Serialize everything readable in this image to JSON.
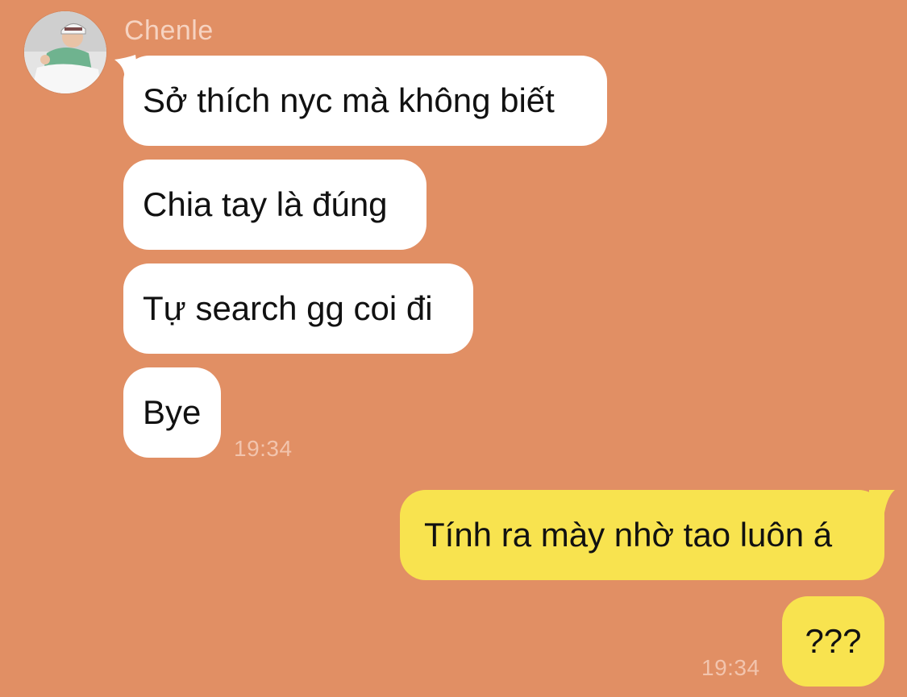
{
  "chat": {
    "contact_name": "Chenle",
    "colors": {
      "background": "#e18f64",
      "incoming_bubble": "#ffffff",
      "outgoing_bubble": "#f8e34f",
      "timestamp": "#f2c4ad"
    },
    "incoming": [
      {
        "text": "Sở thích nyc mà không biết"
      },
      {
        "text": "Chia tay là đúng"
      },
      {
        "text": "Tự search gg coi đi"
      },
      {
        "text": "Bye"
      }
    ],
    "incoming_time": "19:34",
    "outgoing": [
      {
        "text": "Tính ra mày nhờ tao luôn á"
      },
      {
        "text": "???"
      }
    ],
    "outgoing_time": "19:34"
  }
}
